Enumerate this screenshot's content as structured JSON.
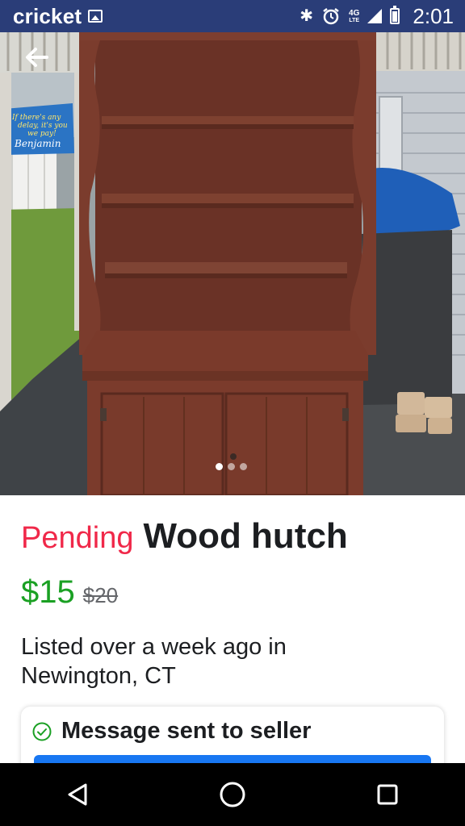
{
  "status_bar": {
    "carrier": "cricket",
    "network_badge": "4G",
    "network_sub": "LTE",
    "time": "2:01",
    "icons": [
      "image-icon",
      "bluetooth-icon",
      "alarm-icon",
      "signal-icon",
      "battery-icon"
    ]
  },
  "photo": {
    "back_icon": "arrow-left-icon",
    "sign_text": [
      "If there's any",
      "delay, it's you",
      "we pay!",
      "Benjamin"
    ],
    "carousel_total": 3,
    "carousel_active": 1
  },
  "listing": {
    "status": "Pending",
    "title": "Wood hutch",
    "price": "$15",
    "original_price": "$20",
    "listed_text": "Listed over a week ago in Newington, CT"
  },
  "message_card": {
    "text": "Message sent to seller",
    "check_icon": "check-circle-icon"
  },
  "nav_bar": {
    "icons": [
      "back-triangle-icon",
      "home-circle-icon",
      "recents-square-icon"
    ]
  },
  "colors": {
    "status_bar": "#2a3d78",
    "pending": "#f02849",
    "price": "#1aa023",
    "button_blue": "#1877f2",
    "check_green": "#1aa023"
  }
}
